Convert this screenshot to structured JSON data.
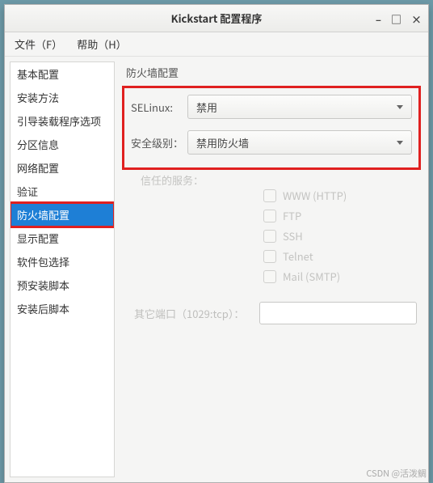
{
  "window": {
    "title": "Kickstart 配置程序"
  },
  "menu": {
    "file": "文件（F）",
    "help": "帮助（H）"
  },
  "sidebar": {
    "items": [
      "基本配置",
      "安装方法",
      "引导装载程序选项",
      "分区信息",
      "网络配置",
      "验证",
      "防火墙配置",
      "显示配置",
      "软件包选择",
      "预安装脚本",
      "安装后脚本"
    ],
    "selected_index": 6
  },
  "main": {
    "section_title": "防火墙配置",
    "selinux_label": "SELinux:",
    "selinux_value": "禁用",
    "level_label": "安全级别：",
    "level_value": "禁用防火墙",
    "trusted_label": "信任的服务：",
    "services": [
      "WWW (HTTP)",
      "FTP",
      "SSH",
      "Telnet",
      "Mail (SMTP)"
    ],
    "ports_label": "其它端口（1029:tcp）：",
    "ports_value": ""
  },
  "watermark": "CSDN @活泼鲷"
}
